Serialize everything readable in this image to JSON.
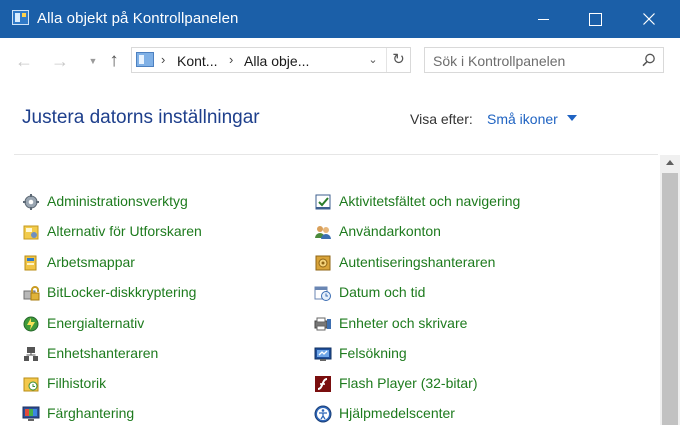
{
  "window": {
    "title": "Alla objekt på Kontrollpanelen",
    "controls": [
      "minimize",
      "maximize",
      "close"
    ]
  },
  "navigation": {
    "breadcrumbs": [
      "Kont...",
      "Alla obje..."
    ],
    "search_placeholder": "Sök i Kontrollpanelen"
  },
  "header": {
    "heading": "Justera datorns inställningar",
    "view_label": "Visa efter:",
    "view_value": "Små ikoner"
  },
  "items_left": [
    {
      "label": "Administrationsverktyg",
      "icon": "administrative-tools-icon"
    },
    {
      "label": "Alternativ för Utforskaren",
      "icon": "folder-options-icon"
    },
    {
      "label": "Arbetsmappar",
      "icon": "work-folders-icon"
    },
    {
      "label": "BitLocker-diskkryptering",
      "icon": "bitlocker-icon"
    },
    {
      "label": "Energialternativ",
      "icon": "power-options-icon"
    },
    {
      "label": "Enhetshanteraren",
      "icon": "device-manager-icon"
    },
    {
      "label": "Filhistorik",
      "icon": "file-history-icon"
    },
    {
      "label": "Färghantering",
      "icon": "color-management-icon"
    }
  ],
  "items_right": [
    {
      "label": "Aktivitetsfältet och navigering",
      "icon": "taskbar-icon"
    },
    {
      "label": "Användarkonton",
      "icon": "user-accounts-icon"
    },
    {
      "label": "Autentiseringshanteraren",
      "icon": "credential-manager-icon"
    },
    {
      "label": "Datum och tid",
      "icon": "date-time-icon"
    },
    {
      "label": "Enheter och skrivare",
      "icon": "devices-printers-icon"
    },
    {
      "label": "Felsökning",
      "icon": "troubleshooting-icon"
    },
    {
      "label": "Flash Player (32-bitar)",
      "icon": "flash-player-icon"
    },
    {
      "label": "Hjälpmedelscenter",
      "icon": "ease-of-access-icon"
    }
  ],
  "colors": {
    "titlebar": "#1b5fa8",
    "heading": "#1e3f8c",
    "link": "#1e7b1e",
    "accent": "#1f63c2"
  }
}
